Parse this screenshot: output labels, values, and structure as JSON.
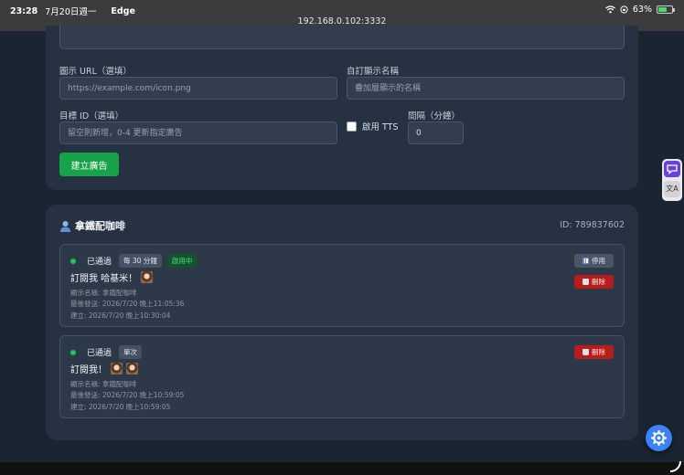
{
  "status_bar": {
    "time": "23:28",
    "date": "7月20日週一",
    "app": "Edge",
    "battery": "63%",
    "battery_level": 0.63,
    "url": "192.168.0.102:3332"
  },
  "form": {
    "icon_url_label": "圖示 URL（選填）",
    "icon_url_placeholder": "https://example.com/icon.png",
    "display_name_label": "自訂顯示名稱",
    "display_name_placeholder": "疊加層顯示的名稱",
    "target_id_label": "目標 ID（選填）",
    "target_id_placeholder": "留空則新增，0-4 更新指定廣告",
    "tts_label": "啟用 TTS",
    "interval_label": "間隔（分鐘）",
    "interval_value": "0",
    "create_button": "建立廣告"
  },
  "streamer": {
    "name": "拿鐵配咖啡",
    "id_text": "ID: 789837602",
    "ads": [
      {
        "status": "已通過",
        "frequency": "每 30 分鐘",
        "active_badge": "啟用中",
        "message": "訂閱我 哈基米！",
        "display_name": "顯示名稱: 拿鐵配咖啡",
        "last_sent": "最後發送: 2026/7/20 晚上11:05:36",
        "created": "建立: 2026/7/20 晚上10:30:04",
        "pause_label": "停用",
        "delete_label": "刪除"
      },
      {
        "status": "已通過",
        "frequency": "單次",
        "message": "訂閱我！",
        "display_name": "顯示名稱: 拿鐵配咖啡",
        "last_sent": "最後發送: 2026/7/20 晚上10:59:05",
        "created": "建立: 2026/7/20 晚上10:59:05",
        "delete_label": "刪除"
      }
    ]
  },
  "icons": {
    "user": "user-icon",
    "settings": "gear-icon",
    "pause": "pause-icon",
    "delete": "trash-icon",
    "wifi": "wifi-icon",
    "translate": "translate-icon"
  }
}
